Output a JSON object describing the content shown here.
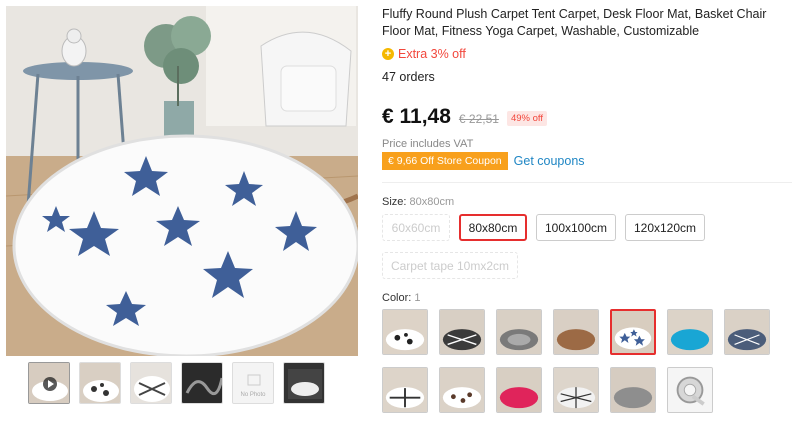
{
  "product": {
    "title": "Fluffy Round Plush Carpet Tent Carpet, Desk Floor Mat, Basket Chair Floor Mat, Fitness Yoga Carpet, Washable, Customizable",
    "extra_discount": "Extra 3% off",
    "orders": "47 orders",
    "price": "€ 11,48",
    "old_price": "€ 22,51",
    "discount": "49% off",
    "vat_note": "Price includes VAT",
    "coupon": "€ 9,66 Off Store Coupon",
    "get_coupons": "Get coupons"
  },
  "size": {
    "label": "Size:",
    "selected": "80x80cm",
    "options": [
      {
        "label": "60x60cm",
        "state": "disabled"
      },
      {
        "label": "80x80cm",
        "state": "selected"
      },
      {
        "label": "100x100cm",
        "state": "available"
      },
      {
        "label": "120x120cm",
        "state": "available"
      },
      {
        "label": "Carpet tape 10mx2cm",
        "state": "disabled"
      }
    ]
  },
  "color": {
    "label": "Color:",
    "selected": "1"
  },
  "thumbnails": {
    "no_photo_label": "No Photo"
  },
  "colors": {
    "accent_red": "#e62e2e",
    "price_red": "#f2473c",
    "coupon_orange": "#f8a01c",
    "link_blue": "#1f86c4",
    "star_blue": "#3f5f98"
  }
}
